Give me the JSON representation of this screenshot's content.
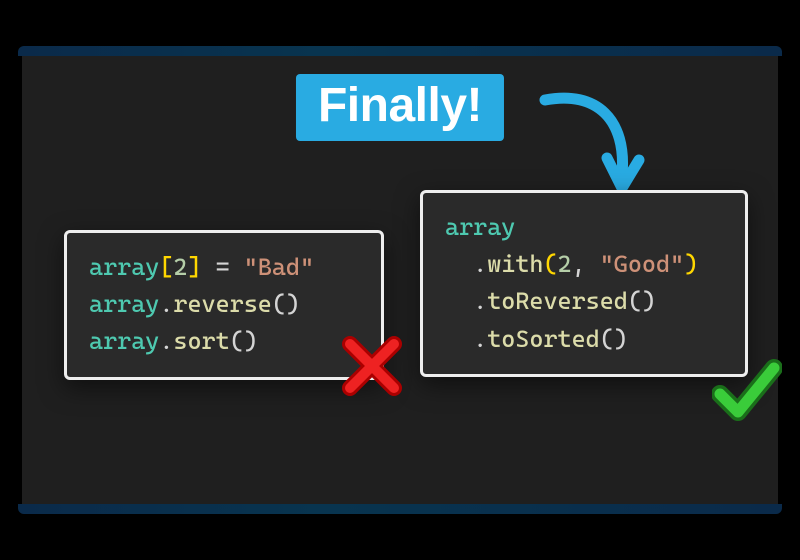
{
  "headline": "Finally!",
  "leftCode": {
    "line1": {
      "var": "array",
      "lbr": "[",
      "idx": "2",
      "rbr": "]",
      "sp": " ",
      "op": "=",
      "sp2": " ",
      "str": "\"Bad\""
    },
    "line2": {
      "var": "array",
      "dot": ".",
      "method": "reverse",
      "paren": "()"
    },
    "line3": {
      "var": "array",
      "dot": ".",
      "method": "sort",
      "paren": "()"
    }
  },
  "rightCode": {
    "line1": {
      "var": "array"
    },
    "line2": {
      "indent": "  ",
      "dot": ".",
      "method": "with",
      "open": "(",
      "arg1": "2",
      "comma": ", ",
      "str": "\"Good\"",
      "close": ")"
    },
    "line3": {
      "indent": "  ",
      "dot": ".",
      "method": "toReversed",
      "paren": "()"
    },
    "line4": {
      "indent": "  ",
      "dot": ".",
      "method": "toSorted",
      "paren": "()"
    }
  },
  "icons": {
    "arrow": "curved-arrow",
    "cross": "cross-mark",
    "check": "check-mark"
  }
}
